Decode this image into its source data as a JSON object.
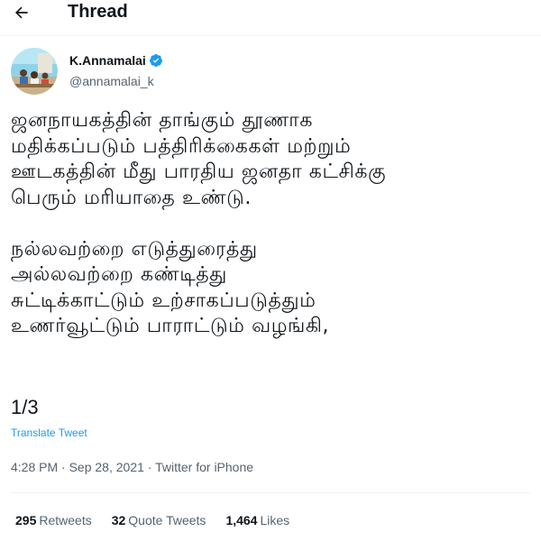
{
  "header": {
    "title": "Thread",
    "back_icon": "arrow-left-icon"
  },
  "author": {
    "name": "K.Annamalai",
    "handle": "@annamalai_k",
    "verified_icon": "verified-badge-icon",
    "verified_color": "#1d9bf0"
  },
  "tweet": {
    "lines": [
      "ஜனநாயகத்தின் தாங்கும் தூணாக",
      "மதிக்கப்படும் பத்திரிக்கைகள் மற்றும்",
      "ஊடகத்தின் மீது பாரதிய ஜனதா கட்சிக்கு",
      "பெரும் மரியாதை உண்டு.",
      "",
      "நல்லவற்றை எடுத்துரைத்து",
      "அல்லவற்றை கண்டித்து",
      "சுட்டிக்காட்டும்  உற்சாகப்படுத்தும்",
      "உணர்வூட்டும் பாராட்டும் வழங்கி,",
      "",
      ""
    ],
    "counter": "1/3",
    "translate_label": "Translate Tweet"
  },
  "meta": {
    "time": "4:28 PM",
    "separator": " · ",
    "date": "Sep 28, 2021",
    "separator2": " · ",
    "source": "Twitter for iPhone"
  },
  "stats": {
    "retweets_count": "295",
    "retweets_label": "Retweets",
    "quotes_count": "32",
    "quotes_label": "Quote Tweets",
    "likes_count": "1,464",
    "likes_label": "Likes"
  },
  "colors": {
    "accent": "#1d9bf0",
    "text_primary": "#0f1419",
    "text_secondary": "#536471",
    "divider": "#eff3f4"
  }
}
